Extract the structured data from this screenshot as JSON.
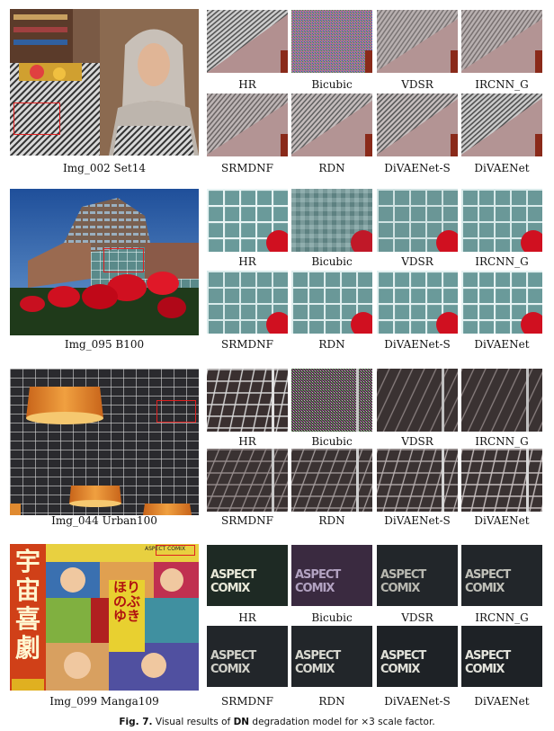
{
  "rows": [
    {
      "main_caption": "Img_002 Set14",
      "top_labels": [
        "HR",
        "Bicubic",
        "VDSR",
        "IRCNN_G"
      ],
      "bottom_labels": [
        "SRMDNF",
        "RDN",
        "DiVAENet-S",
        "DiVAENet"
      ]
    },
    {
      "main_caption": "Img_095 B100",
      "top_labels": [
        "HR",
        "Bicubic",
        "VDSR",
        "IRCNN_G"
      ],
      "bottom_labels": [
        "SRMDNF",
        "RDN",
        "DiVAENet-S",
        "DiVAENet"
      ]
    },
    {
      "main_caption": "Img_044 Urban100",
      "top_labels": [
        "HR",
        "Bicubic",
        "VDSR",
        "IRCNN_G"
      ],
      "bottom_labels": [
        "SRMDNF",
        "RDN",
        "DiVAENet-S",
        "DiVAENet"
      ]
    },
    {
      "main_caption": "Img_099 Manga109",
      "top_labels": [
        "HR",
        "Bicubic",
        "VDSR",
        "IRCNN_G"
      ],
      "bottom_labels": [
        "SRMDNF",
        "RDN",
        "DiVAENet-S",
        "DiVAENet"
      ],
      "cover_title": "宇宙喜劇",
      "cover_publisher": "ASPECT COMIX",
      "cover_author": "ほりのぶゆき",
      "patch_text": "ASPECT COMIX"
    }
  ],
  "figure_caption": {
    "prefix": "Fig. 7.",
    "text_before": "Visual results of",
    "bold_term": "DN",
    "text_after": "degradation model for ×3 scale factor."
  },
  "colors": {
    "roi_box": "#e02020"
  }
}
